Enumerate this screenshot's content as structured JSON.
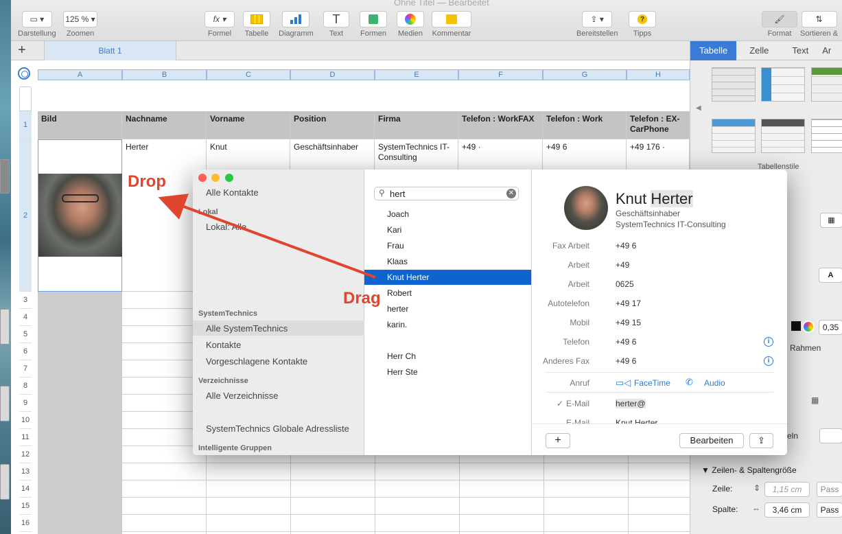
{
  "window": {
    "title": "Ohne Titel — Bearbeitet"
  },
  "toolbar": {
    "darstellung": "Darstellung",
    "zoom_value": "125 %",
    "zoomen": "Zoomen",
    "formel": "Formel",
    "tabelle": "Tabelle",
    "diagramm": "Diagramm",
    "text": "Text",
    "formen": "Formen",
    "medien": "Medien",
    "kommentar": "Kommentar",
    "bereitstellen": "Bereitstellen",
    "tipps": "Tipps",
    "format": "Format",
    "sortieren": "Sortieren &"
  },
  "sheet": {
    "add": "+",
    "tab": "Blatt 1"
  },
  "columns": [
    "A",
    "B",
    "C",
    "D",
    "E",
    "F",
    "G",
    "H"
  ],
  "table": {
    "headers": [
      "Bild",
      "Nachname",
      "Vorname",
      "Position",
      "Firma",
      "Telefon : WorkFAX",
      "Telefon : Work",
      "Telefon : EX-CarPhone"
    ],
    "row2": [
      "",
      "Herter",
      "Knut",
      "Geschäftsinhaber",
      "SystemTechnics IT-Consulting",
      "+49 ·",
      "+49 6",
      "+49 176 ·"
    ]
  },
  "rows": [
    "1",
    "2",
    "3",
    "4",
    "5",
    "6",
    "7",
    "8",
    "9",
    "10",
    "11",
    "12",
    "13",
    "14",
    "15",
    "16"
  ],
  "overlay": {
    "drop": "Drop",
    "drag": "Drag"
  },
  "inspector": {
    "tabs": [
      "Tabelle",
      "Zelle",
      "Text",
      "Ar"
    ],
    "styles_caption": "Tabellenstile",
    "a_button": "A",
    "value_035": "0,35",
    "rahmen": "Rahmen",
    "eln": "eln",
    "size_section": "Zeilen- & Spaltengröße",
    "zeile_label": "Zeile:",
    "zeile_value": "1,15 cm",
    "spalte_label": "Spalte:",
    "spalte_value": "3,46 cm",
    "pass": "Pass"
  },
  "contacts": {
    "sidebar": {
      "all": "Alle Kontakte",
      "lokal_head": "Lokal",
      "lokal_all": "Lokal: Alle",
      "st_head": "SystemTechnics",
      "st_all": "Alle SystemTechnics",
      "st_kontakte": "Kontakte",
      "st_vorgeschlagen": "Vorgeschlagene Kontakte",
      "verz_head": "Verzeichnisse",
      "verz_all": "Alle Verzeichnisse",
      "global": "SystemTechnics Globale Adressliste",
      "smart_head": "Intelligente Gruppen"
    },
    "search": {
      "value": "hert"
    },
    "list": [
      "Joach",
      "Kari",
      "Frau",
      "Klaas",
      "Knut Herter",
      "Robert",
      "herter",
      "karin.",
      "",
      "Herr Ch",
      "Herr Ste"
    ],
    "selected_index": 4,
    "detail": {
      "first": "Knut",
      "last": "Herter",
      "title": "Geschäftsinhaber",
      "company": "SystemTechnics IT-Consulting",
      "fields": [
        {
          "label": "Fax Arbeit",
          "value": "+49 6"
        },
        {
          "label": "Arbeit",
          "value": "+49"
        },
        {
          "label": "Arbeit",
          "value": "0625"
        },
        {
          "label": "Autotelefon",
          "value": "+49 17"
        },
        {
          "label": "Mobil",
          "value": "+49 15"
        },
        {
          "label": "Telefon",
          "value": "+49 6"
        },
        {
          "label": "Anderes Fax",
          "value": "+49 6"
        }
      ],
      "anruf": "Anruf",
      "facetime": "FaceTime",
      "audio": "Audio",
      "email_label": "E-Mail",
      "email_value": "herter@",
      "email2_label": "E-Mail",
      "email2_value": "Knut.Herter",
      "add": "+",
      "edit": "Bearbeiten"
    }
  }
}
